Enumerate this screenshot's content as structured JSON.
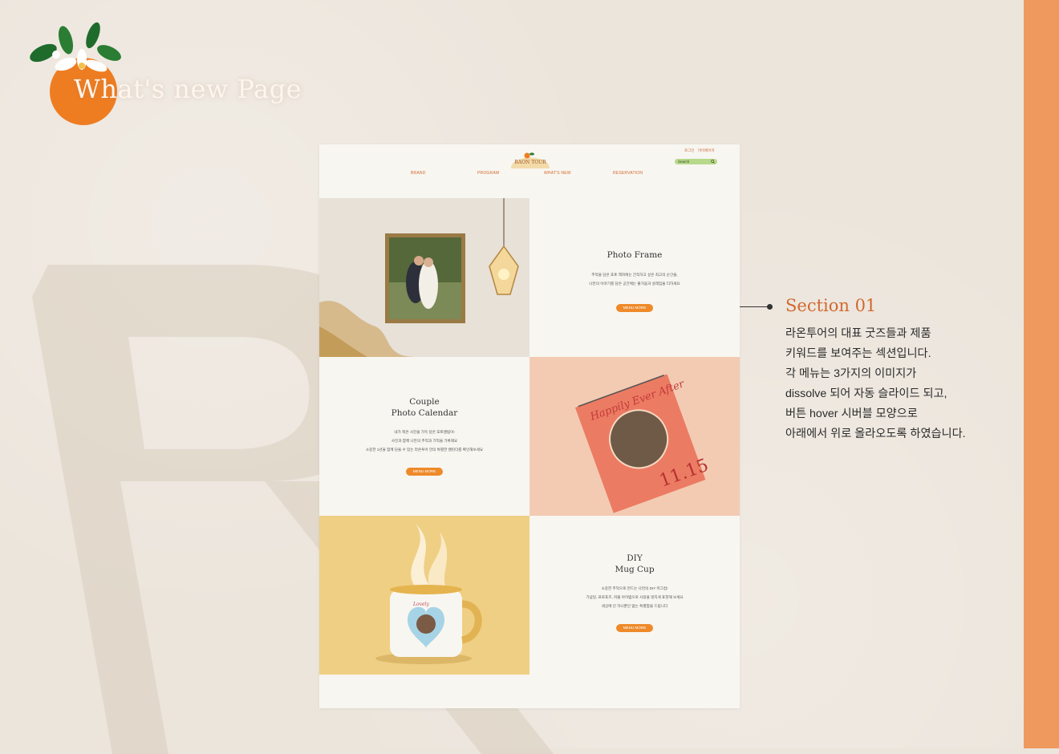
{
  "page": {
    "heading": "What's new Page",
    "accent": "#f0995f",
    "background": "#ece5dc"
  },
  "site": {
    "logo_text": "RAON TOUR",
    "util_links": [
      "로그인",
      "마이페이지"
    ],
    "search_placeholder": "Search",
    "nav": [
      "BRAND",
      "PROGRAM",
      "WHAT'S NEW",
      "RESERVATION"
    ],
    "sections": [
      {
        "title_lines": [
          "Photo Frame"
        ],
        "desc_lines": [
          "추억을 담은 포토 액자에는 간직하고 싶은 최고의 순간을,",
          "나만의 이야기를 담은 공간에는 즐거움과 설레임을 더하세요"
        ],
        "button": "MENU MORE"
      },
      {
        "title_lines": [
          "Couple",
          "Photo Calendar"
        ],
        "desc_lines": [
          "내가 찍은 사진을 가득 담은 포토앨범이!",
          "사진과 함께 나만의 추억과 기억을 기록해요",
          "소중한 1년을 함께 담을 수 있는 라온투어 만의 특별한 캘린더를 확인해보세요"
        ],
        "button": "MENU MORE"
      },
      {
        "title_lines": [
          "DIY",
          "Mug Cup"
        ],
        "desc_lines": [
          "소중한 추억으로 만드는 나만의 DIY 머그컵!",
          "기념일, 프로포즈, 커플 아이템으로 사랑을 멋지게 표현해 보세요",
          "세상에 단 하나뿐인 없는 특별함을 드립니다"
        ],
        "button": "MENU MORE"
      }
    ],
    "calendar_text": {
      "script": "Happily Ever After",
      "date": "11.15"
    },
    "mug_text": "Lovely"
  },
  "annotation": {
    "title": "Section 01",
    "lines": [
      "라온투어의 대표 굿즈들과 제품",
      "키워드를 보여주는 섹션입니다.",
      "각 메뉴는 3가지의 이미지가",
      "dissolve  되어 자동  슬라이드 되고,",
      "버튼 hover 시버블 모양으로",
      "아래에서 위로 올라오도록 하였습니다."
    ]
  },
  "icons": [
    "orange-flower-icon",
    "search-icon",
    "brand-sun-icon"
  ]
}
